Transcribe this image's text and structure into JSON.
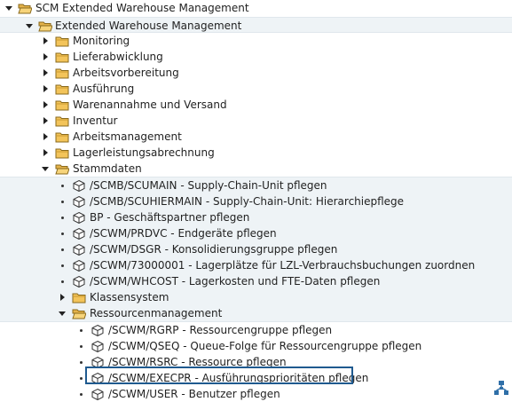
{
  "tree": {
    "root": "SCM Extended Warehouse Management",
    "ewm": "Extended Warehouse Management",
    "folders": {
      "monitoring": "Monitoring",
      "lieferabwicklung": "Lieferabwicklung",
      "arbeitsvorbereitung": "Arbeitsvorbereitung",
      "ausfuehrung": "Ausführung",
      "warenannahme": "Warenannahme und Versand",
      "inventur": "Inventur",
      "arbeitsmanagement": "Arbeitsmanagement",
      "lagerleistung": "Lagerleistungsabrechnung",
      "stammdaten": "Stammdaten"
    },
    "stammdaten_items": {
      "scumain": "/SCMB/SCUMAIN - Supply-Chain-Unit pflegen",
      "scuhiermain": "/SCMB/SCUHIERMAIN - Supply-Chain-Unit: Hierarchiepflege",
      "bp": "BP - Geschäftspartner pflegen",
      "prdvc": "/SCWM/PRDVC - Endgeräte pflegen",
      "dsgr": "/SCWM/DSGR - Konsolidierungsgruppe pflegen",
      "t73000001": "/SCWM/73000001 - Lagerplätze für LZL-Verbrauchsbuchungen zuordnen",
      "whcost": "/SCWM/WHCOST - Lagerkosten und FTE-Daten pflegen",
      "klassensystem": "Klassensystem",
      "ressourcenmanagement": "Ressourcenmanagement"
    },
    "ressourcen_items": {
      "rgrp": "/SCWM/RGRP - Ressourcengruppe pflegen",
      "qseq": "/SCWM/QSEQ - Queue-Folge für Ressourcengruppe pflegen",
      "rsrc": "/SCWM/RSRC - Ressource pflegen",
      "execpr": "/SCWM/EXECPR - Ausführungsprioritäten pflegen",
      "user": "/SCWM/USER - Benutzer pflegen"
    }
  },
  "icons": {
    "folder_open": "folder-open-icon",
    "folder_closed": "folder-icon",
    "transaction": "cube-icon",
    "expand": "triangle-right-icon",
    "collapse": "triangle-down-icon",
    "structure": "structure-icon"
  },
  "colors": {
    "folder": "#f3c45a",
    "highlight_border": "#1f5a8f",
    "band": "#eef3f6",
    "structure_icon": "#2f6fa8"
  }
}
